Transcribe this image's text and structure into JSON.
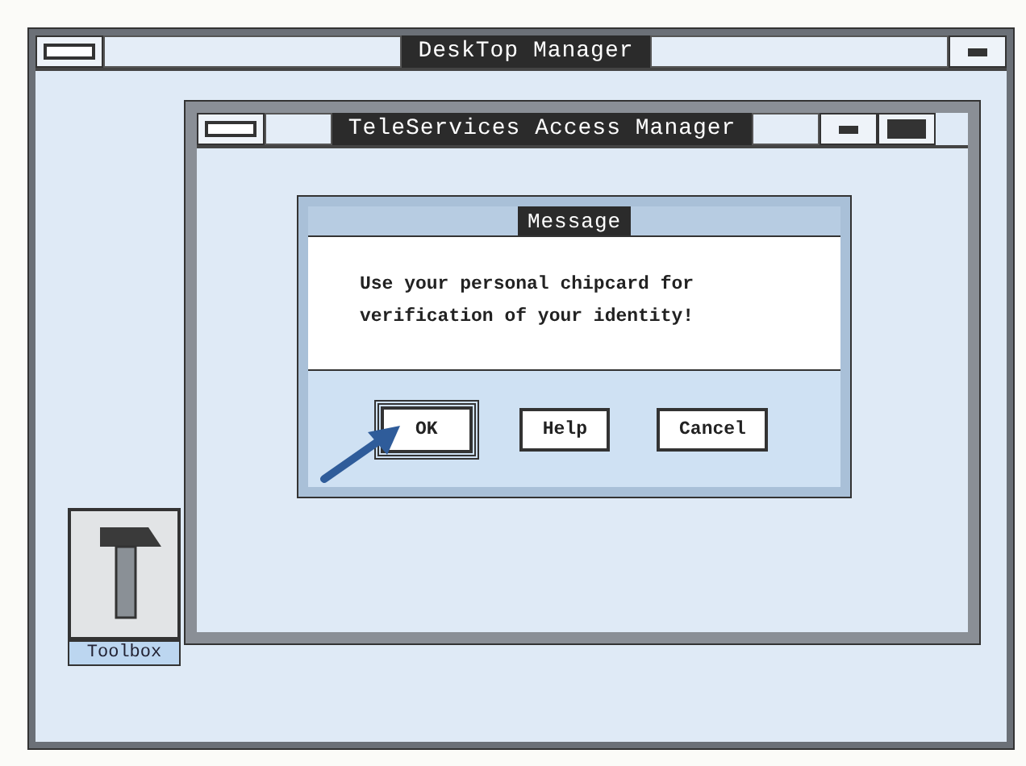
{
  "desktop_window": {
    "title": "DeskTop Manager"
  },
  "app_window": {
    "title": "TeleServices Access Manager"
  },
  "dialog": {
    "title": "Message",
    "message": "Use your personal chipcard for verification of your identity!",
    "buttons": [
      {
        "label": "OK",
        "selected": true
      },
      {
        "label": "Help",
        "selected": false
      },
      {
        "label": "Cancel",
        "selected": false
      }
    ]
  },
  "desktop_icons": [
    {
      "label": "Toolbox"
    }
  ]
}
